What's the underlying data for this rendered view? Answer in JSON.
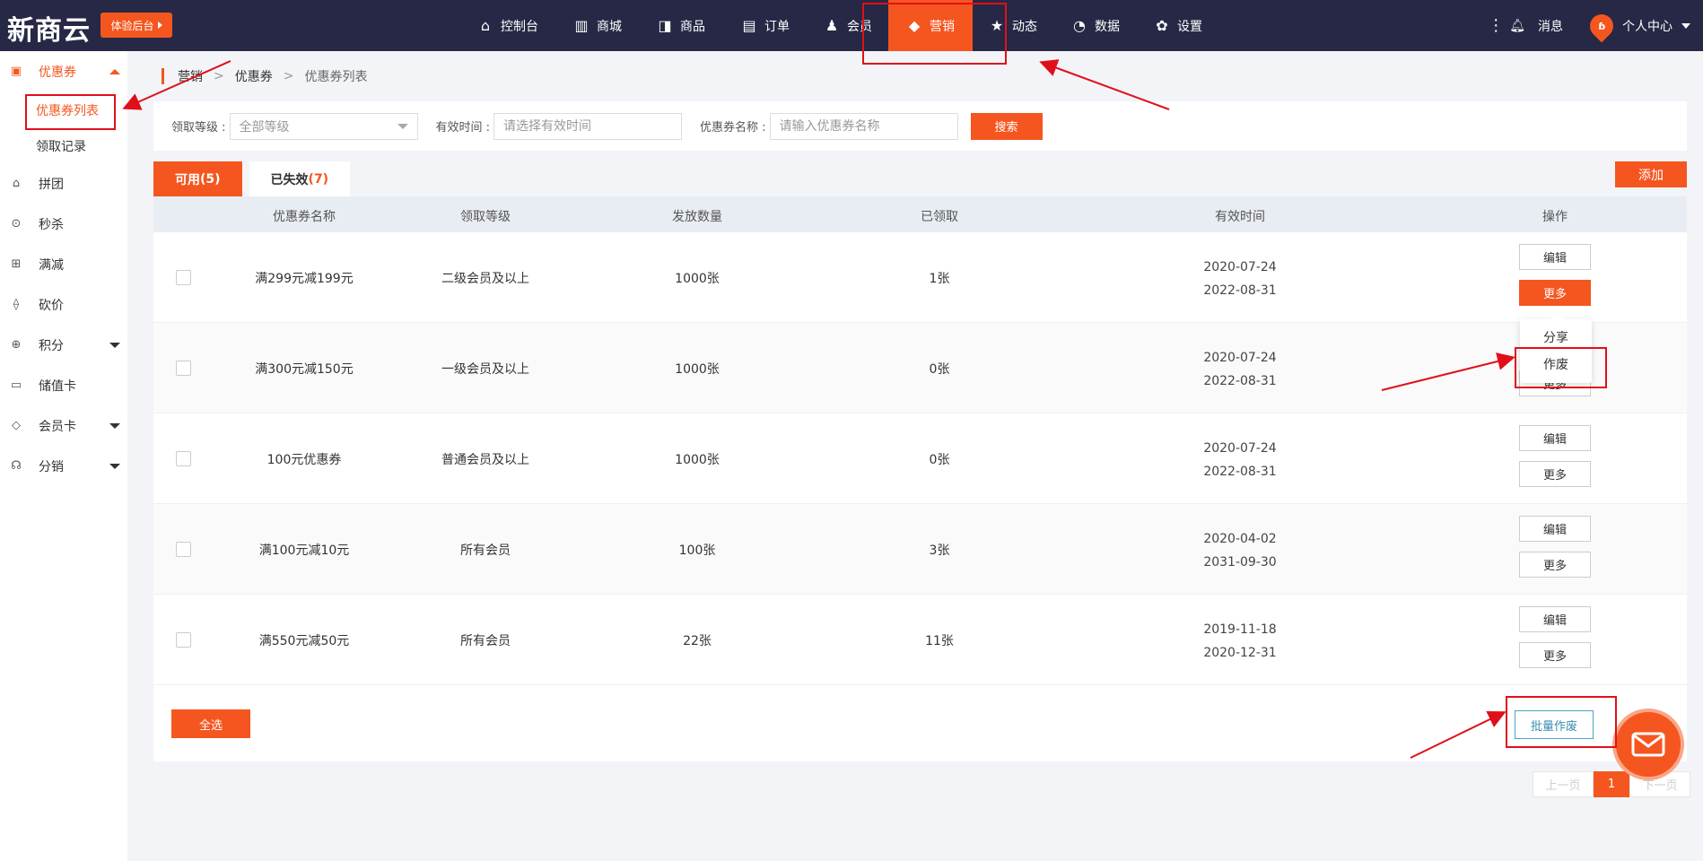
{
  "topbar": {
    "logo": "新商云",
    "trial_label": "体验后台",
    "nav": [
      {
        "label": "控制台",
        "icon": "home-icon",
        "glyph": "⌂"
      },
      {
        "label": "商城",
        "icon": "building-icon",
        "glyph": "▥"
      },
      {
        "label": "商品",
        "icon": "bag-icon",
        "glyph": "◨"
      },
      {
        "label": "订单",
        "icon": "list-icon",
        "glyph": "▤"
      },
      {
        "label": "会员",
        "icon": "user-icon",
        "glyph": "♟"
      },
      {
        "label": "营销",
        "icon": "cube-icon",
        "glyph": "◆",
        "active": true
      },
      {
        "label": "动态",
        "icon": "star-icon",
        "glyph": "★"
      },
      {
        "label": "数据",
        "icon": "pie-chart-icon",
        "glyph": "◔"
      },
      {
        "label": "设置",
        "icon": "gear-icon",
        "glyph": "✿"
      }
    ],
    "messages_label": "消息",
    "user_label": "个人中心"
  },
  "sidebar": {
    "items": [
      {
        "label": "优惠券",
        "icon": "coupon-icon",
        "glyph": "▣",
        "active": true,
        "arrow": "up"
      },
      {
        "label": "拼团",
        "icon": "basket-icon",
        "glyph": "⌂"
      },
      {
        "label": "秒杀",
        "icon": "clock-icon",
        "glyph": "⊙"
      },
      {
        "label": "满减",
        "icon": "gift-icon",
        "glyph": "⊞"
      },
      {
        "label": "砍价",
        "icon": "tag-icon",
        "glyph": "⟠"
      },
      {
        "label": "积分",
        "icon": "points-icon",
        "glyph": "⊕",
        "arrow": "down"
      },
      {
        "label": "储值卡",
        "icon": "card-icon",
        "glyph": "▭"
      },
      {
        "label": "会员卡",
        "icon": "diamond-icon",
        "glyph": "◇",
        "arrow": "down"
      },
      {
        "label": "分销",
        "icon": "share-network-icon",
        "glyph": "☊",
        "arrow": "down"
      }
    ],
    "sub_items": [
      {
        "label": "优惠券列表",
        "active": true
      },
      {
        "label": "领取记录"
      }
    ]
  },
  "breadcrumb": [
    "营销",
    "优惠券",
    "优惠券列表"
  ],
  "filter": {
    "level_label": "领取等级 :",
    "level_value": "全部等级",
    "time_label": "有效时间 :",
    "time_placeholder": "请选择有效时间",
    "name_label": "优惠券名称 :",
    "name_placeholder": "请输入优惠券名称",
    "search_label": "搜索"
  },
  "tabs": [
    {
      "label": "可用",
      "count": "(5)",
      "active": true
    },
    {
      "label": "已失效",
      "count": "(7)"
    }
  ],
  "add_label": "添加",
  "table": {
    "headers": [
      "优惠券名称",
      "领取等级",
      "发放数量",
      "已领取",
      "有效时间",
      "操作"
    ],
    "rows": [
      {
        "name": "满299元减199元",
        "level": "二级会员及以上",
        "qty": "1000张",
        "received": "1张",
        "start": "2020-07-24",
        "end": "2022-08-31"
      },
      {
        "name": "满300元减150元",
        "level": "一级会员及以上",
        "qty": "1000张",
        "received": "0张",
        "start": "2020-07-24",
        "end": "2022-08-31"
      },
      {
        "name": "100元优惠券",
        "level": "普通会员及以上",
        "qty": "1000张",
        "received": "0张",
        "start": "2020-07-24",
        "end": "2022-08-31"
      },
      {
        "name": "满100元减10元",
        "level": "所有会员",
        "qty": "100张",
        "received": "3张",
        "start": "2020-04-02",
        "end": "2031-09-30"
      },
      {
        "name": "满550元减50元",
        "level": "所有会员",
        "qty": "22张",
        "received": "11张",
        "start": "2019-11-18",
        "end": "2020-12-31"
      }
    ],
    "edit_label": "编辑",
    "more_label": "更多"
  },
  "dropdown": {
    "share": "分享",
    "void": "作废"
  },
  "footer": {
    "select_all": "全选",
    "batch_void": "批量作废"
  },
  "pager": {
    "prev": "上一页",
    "page": "1",
    "next": "下一页"
  },
  "colors": {
    "accent": "#f5561f",
    "topbar": "#262845",
    "annotation": "#e0101a"
  }
}
